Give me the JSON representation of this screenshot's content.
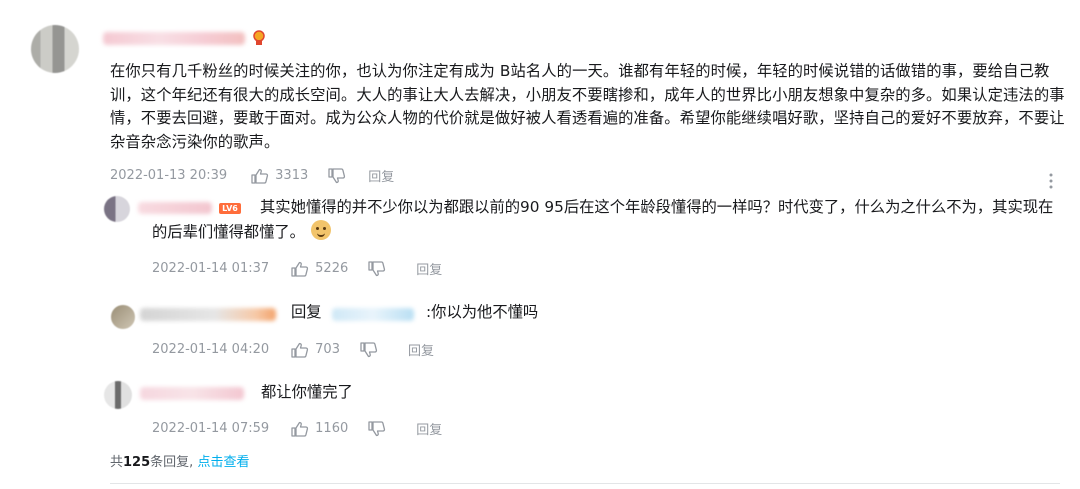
{
  "comment": {
    "text": "在你只有几千粉丝的时候关注的你，也认为你注定有成为 B站名人的一天。谁都有年轻的时候，年轻的时候说错的话做错的事，要给自己教训，这个年纪还有很大的成长空间。大人的事让大人去解决，小朋友不要瞎掺和，成年人的世界比小朋友想象中复杂的多。如果认定违法的事情，不要去回避，要敢于面对。成为公众人物的代价就是做好被人看透看遍的准备。希望你能继续唱好歌，坚持自己的爱好不要放弃，不要让杂音杂念污染你的歌声。",
    "time": "2022-01-13 20:39",
    "likes": "3313",
    "reply_label": "回复"
  },
  "replies": [
    {
      "level_badge": "LV6",
      "text": "其实她懂得的并不少你以为都跟以前的90 95后在这个年龄段懂得的一样吗？时代变了，什么为之什么不为，其实现在的后辈们懂得都懂了。",
      "time": "2022-01-14 01:37",
      "likes": "5226",
      "reply_label": "回复"
    },
    {
      "reply_prefix": "回复",
      "text": ":你以为他不懂吗",
      "time": "2022-01-14 04:20",
      "likes": "703",
      "reply_label": "回复"
    },
    {
      "text": "都让你懂完了",
      "time": "2022-01-14 07:59",
      "likes": "1160",
      "reply_label": "回复"
    }
  ],
  "footer": {
    "total_prefix": "共",
    "total_count": "125",
    "total_suffix": "条回复,",
    "click_label": "点击查看"
  },
  "icons": {
    "like": "thumbs-up-icon",
    "dislike": "thumbs-down-icon",
    "more": "more-vertical-icon",
    "badge": "medal-icon",
    "emoji": "doge-emoji-icon"
  },
  "colors": {
    "meta": "#9499a0",
    "link": "#00aeec",
    "level_badge": "#ff6d3b"
  }
}
